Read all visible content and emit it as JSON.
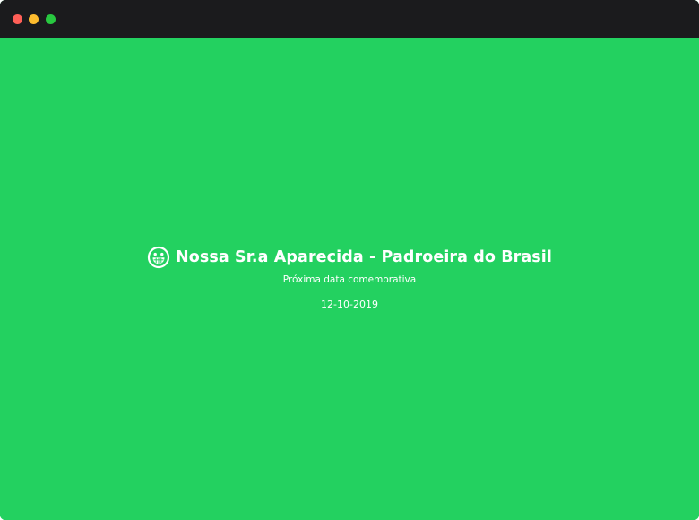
{
  "window": {
    "controls": [
      "close",
      "minimize",
      "maximize"
    ],
    "colors": {
      "titlebar": "#1b1b1d",
      "close": "#ff5f57",
      "minimize": "#febc2e",
      "maximize": "#28c840"
    }
  },
  "page": {
    "background_color": "#23d160",
    "icon": "grinning-face-icon",
    "title": "Nossa Sr.a Aparecida - Padroeira do Brasil",
    "subtitle": "Próxima data comemorativa",
    "date": "12-10-2019"
  }
}
